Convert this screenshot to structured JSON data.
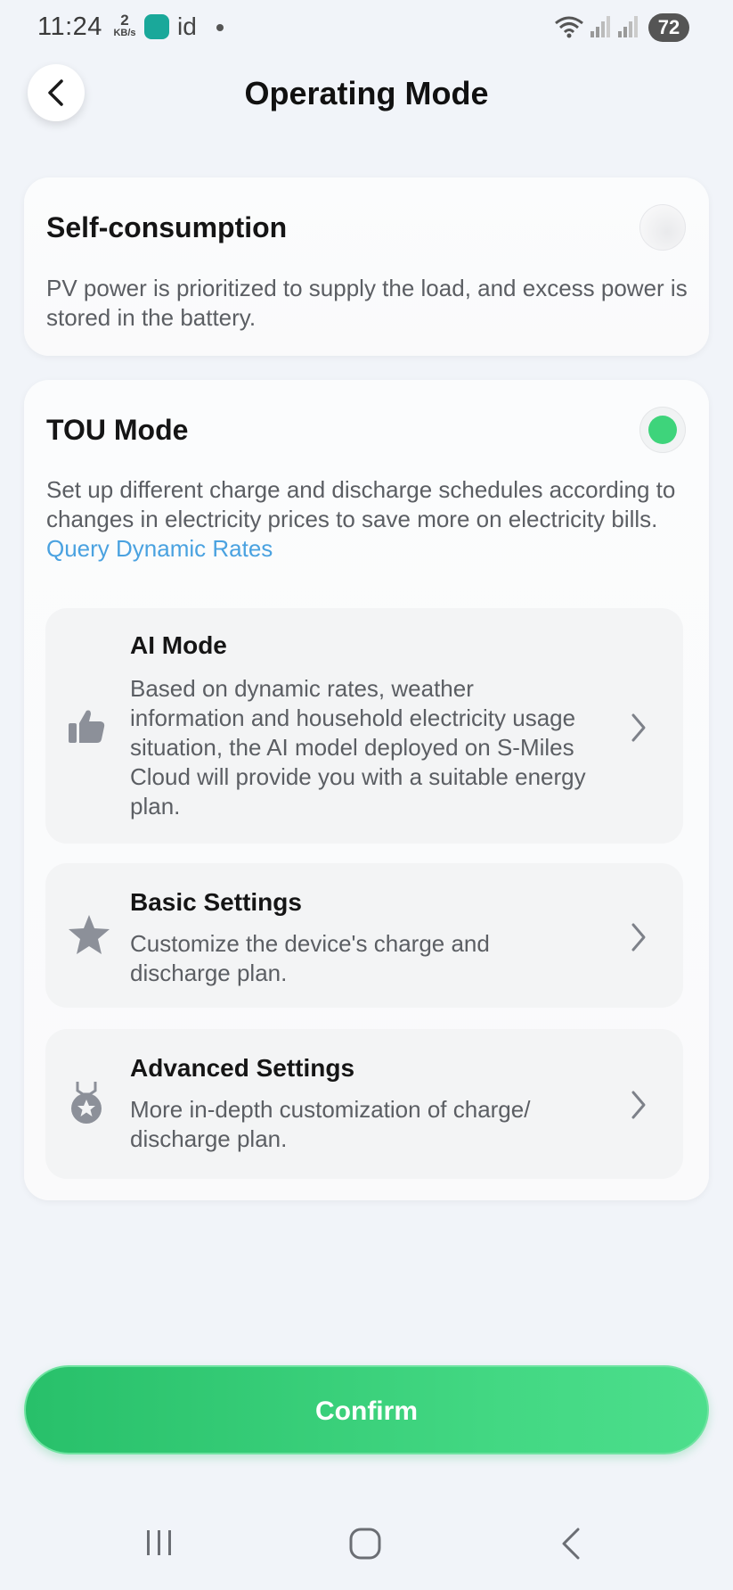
{
  "status_bar": {
    "time": "11:24",
    "net_speed_value": "2",
    "net_speed_unit": "KB/s",
    "app_label": "id",
    "battery": "72",
    "wifi_icon": "wifi-icon",
    "signal_icon": "signal-icon"
  },
  "header": {
    "title": "Operating Mode",
    "back_icon": "chevron-left-icon"
  },
  "modes": {
    "self_consumption": {
      "title": "Self-consumption",
      "description": "PV power is prioritized to supply the load, and excess power is stored in the battery.",
      "selected": false
    },
    "tou": {
      "title": "TOU Mode",
      "description": "Set up different charge and discharge schedules according to changes in electricity prices to save more on electricity bills.",
      "link": "Query Dynamic Rates",
      "selected": true,
      "options": [
        {
          "title": "AI Mode",
          "description": "Based on dynamic rates, weather information and household electricity usage situation, the AI model deployed on S-Miles Cloud will provide you with a suitable energy plan.",
          "icon": "thumbs-up-icon"
        },
        {
          "title": "Basic Settings",
          "description": "Customize the device's charge and discharge plan.",
          "icon": "star-icon"
        },
        {
          "title": "Advanced Settings",
          "description": "More in-depth customization of charge/ discharge plan.",
          "icon": "medal-icon"
        }
      ]
    }
  },
  "actions": {
    "confirm_label": "Confirm"
  },
  "colors": {
    "accent_green": "#3ed47b",
    "link_blue": "#4aa2e0",
    "background": "#f1f4f9"
  }
}
